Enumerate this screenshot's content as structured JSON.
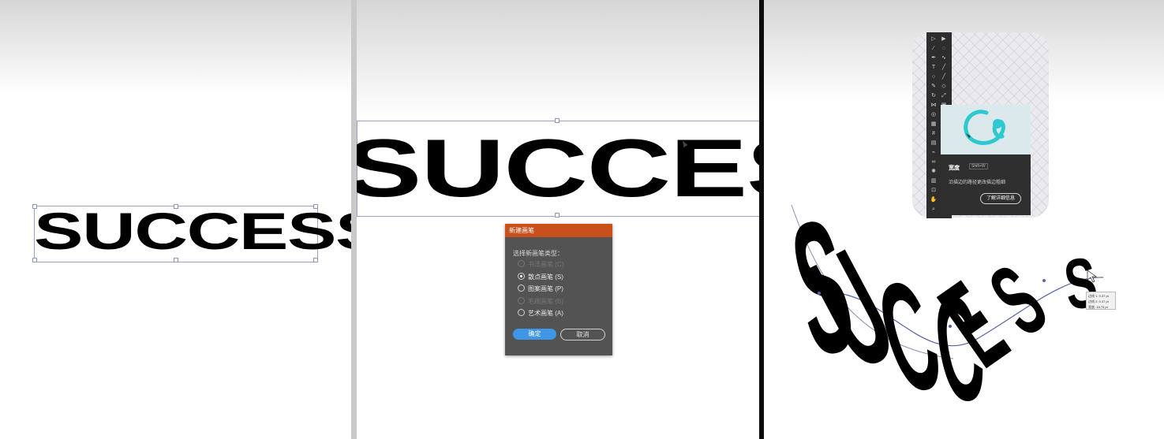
{
  "panels": {
    "left": {
      "word": "SUCCESS"
    },
    "middle": {
      "word": "SUCCESS",
      "dialog": {
        "title": "新建画笔",
        "prompt": "选择新画笔类型：",
        "options": [
          {
            "label": "书法画笔 (C)",
            "enabled": false,
            "selected": false
          },
          {
            "label": "散点画笔 (S)",
            "enabled": true,
            "selected": true
          },
          {
            "label": "图案画笔 (P)",
            "enabled": true,
            "selected": false
          },
          {
            "label": "毛刷画笔 (B)",
            "enabled": false,
            "selected": false
          },
          {
            "label": "艺术画笔 (A)",
            "enabled": true,
            "selected": false
          }
        ],
        "ok_label": "确定",
        "cancel_label": "取消",
        "title_color": "#c9501b",
        "ok_color": "#3f96e6"
      }
    },
    "right": {
      "letters": [
        "S",
        "U",
        "C",
        "C",
        "E",
        "S",
        "S"
      ],
      "tooltip": {
        "name": "宽度",
        "shortcut": "Shift+W",
        "description": "沿描边的路径更改描边粗细",
        "learn_more": "了解详细信息",
        "preview_color": "#2cc9cf"
      },
      "measure": {
        "line1": "边线 1: 9.37 pt",
        "line2": "边线 2: 9.37 pt",
        "line3": "宽度: 18.75 pt"
      }
    }
  }
}
